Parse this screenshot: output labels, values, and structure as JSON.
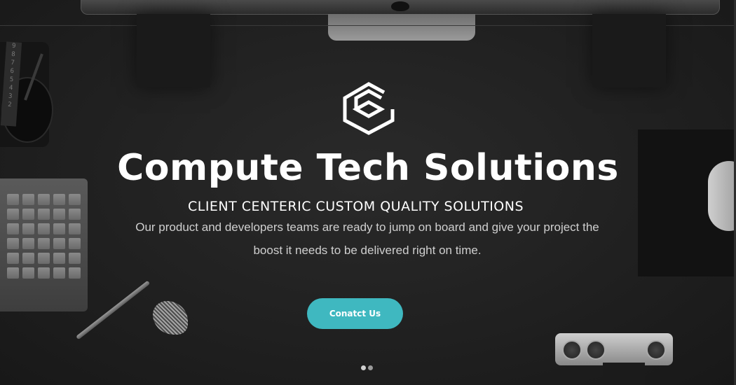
{
  "hero": {
    "title": "Compute Tech Solutions",
    "tagline": "CLIENT CENTERIC CUSTOM QUALITY SOLUTIONS",
    "description": "Our product and developers teams are ready to jump on board and give your project the boost it needs to be delivered right on time.",
    "cta_label": "Conatct Us",
    "logo_icon": "hexagon-c-logo-icon"
  },
  "slider": {
    "slide_count": 2,
    "active_index": 0
  },
  "colors": {
    "accent": "#3fb8c0",
    "text": "#ffffff",
    "muted_text": "#cfcfcf",
    "background": "#1e1e1e"
  }
}
